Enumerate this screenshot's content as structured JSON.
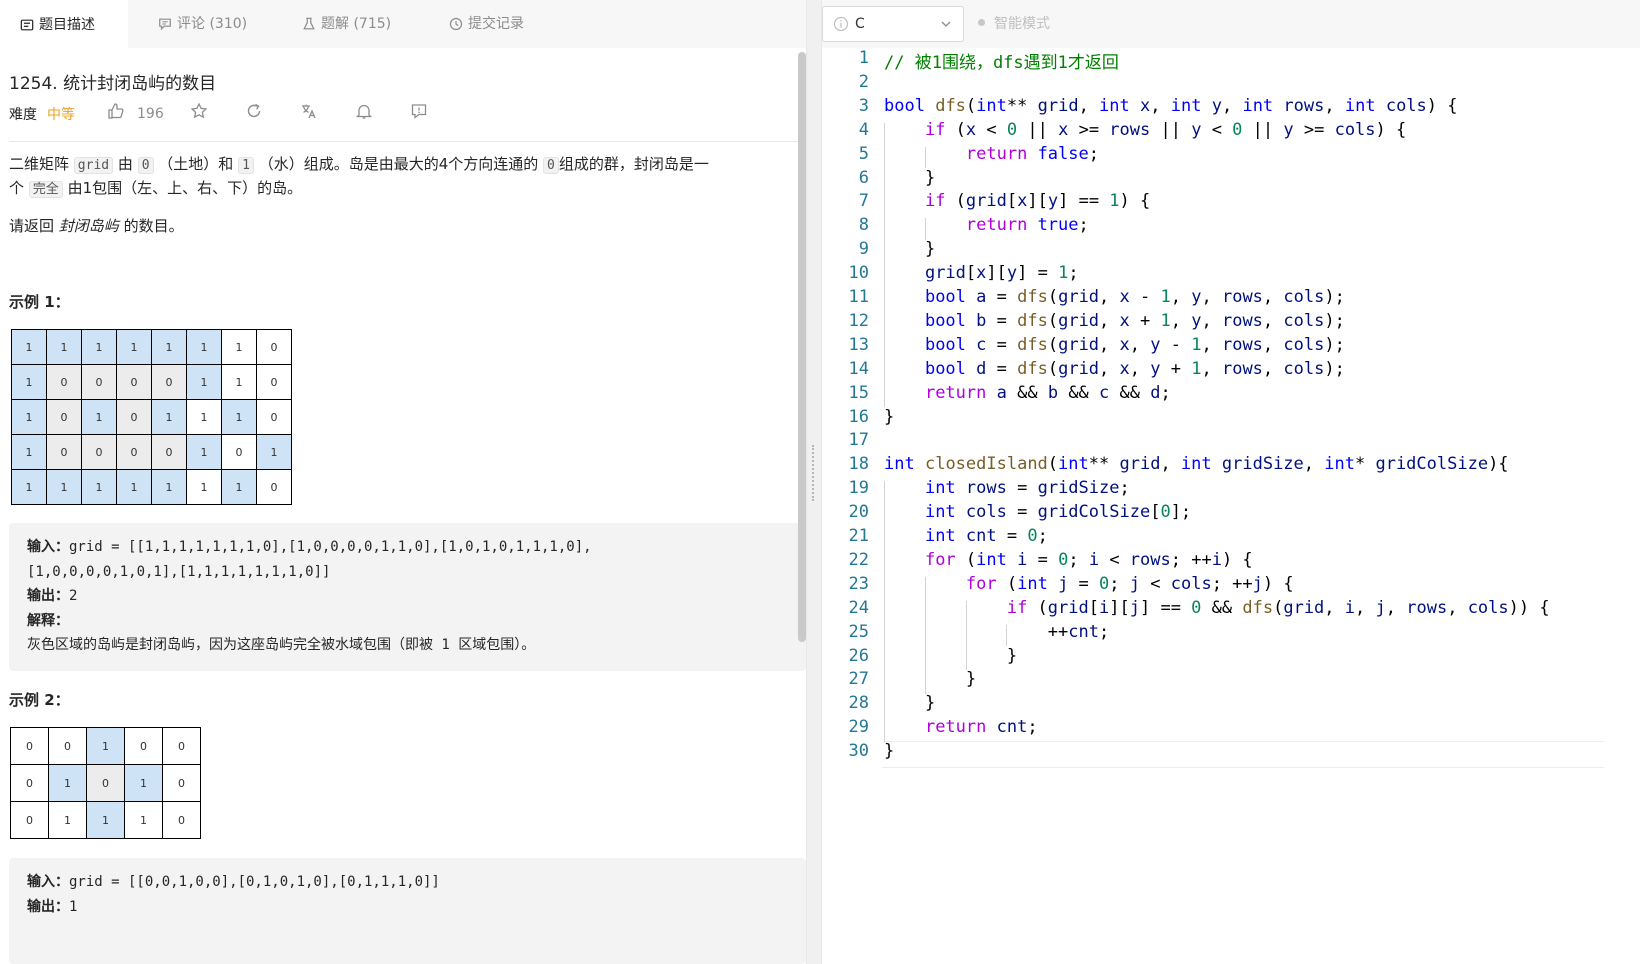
{
  "tabs": [
    {
      "label": "题目描述",
      "icon": "description-icon",
      "active": true
    },
    {
      "label": "评论 (310)",
      "icon": "comment-icon",
      "active": false
    },
    {
      "label": "题解 (715)",
      "icon": "flask-icon",
      "active": false
    },
    {
      "label": "提交记录",
      "icon": "history-icon",
      "active": false
    }
  ],
  "problem": {
    "title": "1254. 统计封闭岛屿的数目",
    "difficulty_label": "难度",
    "difficulty_value": "中等",
    "likes": "196",
    "desc1_a": "二维矩阵",
    "desc1_code1": "grid",
    "desc1_b": "由",
    "desc1_code2": "0",
    "desc1_c": "（土地）和",
    "desc1_code3": "1",
    "desc1_d": "（水）组成。岛是由最大的4个方向连通的",
    "desc1_code4": "0",
    "desc1_e": "组成的群，封闭岛是一",
    "desc2_a": "个",
    "desc2_code": "完全",
    "desc2_b": "由1包围（左、上、右、下）的岛。",
    "desc3_a": "请返回",
    "desc3_em": "封闭岛屿",
    "desc3_b": "的数目。"
  },
  "example1": {
    "heading": "示例 1：",
    "grid": [
      [
        "1",
        "1",
        "1",
        "1",
        "1",
        "1",
        "1",
        "0"
      ],
      [
        "1",
        "0",
        "0",
        "0",
        "0",
        "1",
        "1",
        "0"
      ],
      [
        "1",
        "0",
        "1",
        "0",
        "1",
        "1",
        "1",
        "0"
      ],
      [
        "1",
        "0",
        "0",
        "0",
        "0",
        "1",
        "0",
        "1"
      ],
      [
        "1",
        "1",
        "1",
        "1",
        "1",
        "1",
        "1",
        "0"
      ]
    ],
    "cell_style": [
      [
        "w",
        "w",
        "w",
        "w",
        "w",
        "w",
        "e",
        "e"
      ],
      [
        "w",
        "l",
        "l",
        "l",
        "l",
        "w",
        "e",
        "e"
      ],
      [
        "w",
        "l",
        "w",
        "l",
        "w",
        "e",
        "w",
        "e"
      ],
      [
        "w",
        "l",
        "l",
        "l",
        "l",
        "w",
        "e",
        "w"
      ],
      [
        "w",
        "w",
        "w",
        "w",
        "w",
        "e",
        "w",
        "e"
      ]
    ],
    "input_label": "输入：",
    "input_line1": "grid = [[1,1,1,1,1,1,1,0],[1,0,0,0,0,1,1,0],[1,0,1,0,1,1,1,0],",
    "input_line2": "[1,0,0,0,0,1,0,1],[1,1,1,1,1,1,1,0]]",
    "output_label": "输出：",
    "output_value": "2",
    "explain_label": "解释：",
    "explain_a": "灰色区域的岛屿是封闭岛屿，因为这座岛屿完全被水域包围（即被",
    "explain_code": " 1 ",
    "explain_b": "区域包围）。"
  },
  "example2": {
    "heading": "示例 2：",
    "grid": [
      [
        "0",
        "0",
        "1",
        "0",
        "0"
      ],
      [
        "0",
        "1",
        "0",
        "1",
        "0"
      ],
      [
        "0",
        "1",
        "1",
        "1",
        "0"
      ]
    ],
    "cell_style": [
      [
        "e",
        "e",
        "w",
        "e",
        "e"
      ],
      [
        "e",
        "w",
        "l",
        "w",
        "e"
      ],
      [
        "e",
        "e",
        "w",
        "e",
        "e"
      ]
    ],
    "input_label": "输入：",
    "input_line1": "grid = [[0,0,1,0,0],[0,1,0,1,0],[0,1,1,1,0]]",
    "output_label": "输出：",
    "output_value": "1"
  },
  "editor": {
    "language": "C",
    "mode_label": "智能模式",
    "code_lines": [
      "// 被1围绕，dfs遇到1才返回",
      "",
      "bool dfs(int** grid, int x, int y, int rows, int cols) {",
      "    if (x < 0 || x >= rows || y < 0 || y >= cols) {",
      "        return false;",
      "    }",
      "    if (grid[x][y] == 1) {",
      "        return true;",
      "    }",
      "    grid[x][y] = 1;",
      "    bool a = dfs(grid, x - 1, y, rows, cols);",
      "    bool b = dfs(grid, x + 1, y, rows, cols);",
      "    bool c = dfs(grid, x, y - 1, rows, cols);",
      "    bool d = dfs(grid, x, y + 1, rows, cols);",
      "    return a && b && c && d;",
      "}",
      "",
      "int closedIsland(int** grid, int gridSize, int* gridColSize){",
      "    int rows = gridSize;",
      "    int cols = gridColSize[0];",
      "    int cnt = 0;",
      "    for (int i = 0; i < rows; ++i) {",
      "        for (int j = 0; j < cols; ++j) {",
      "            if (grid[i][j] == 0 && dfs(grid, i, j, rows, cols)) {",
      "                ++cnt;",
      "            }",
      "        }",
      "    }",
      "    return cnt;",
      "}"
    ]
  },
  "colors": {
    "accent_difficulty": "#f0a020",
    "water_cell": "#cfe3f7",
    "closed_island_cell": "#ececec",
    "line_number": "#237893"
  }
}
